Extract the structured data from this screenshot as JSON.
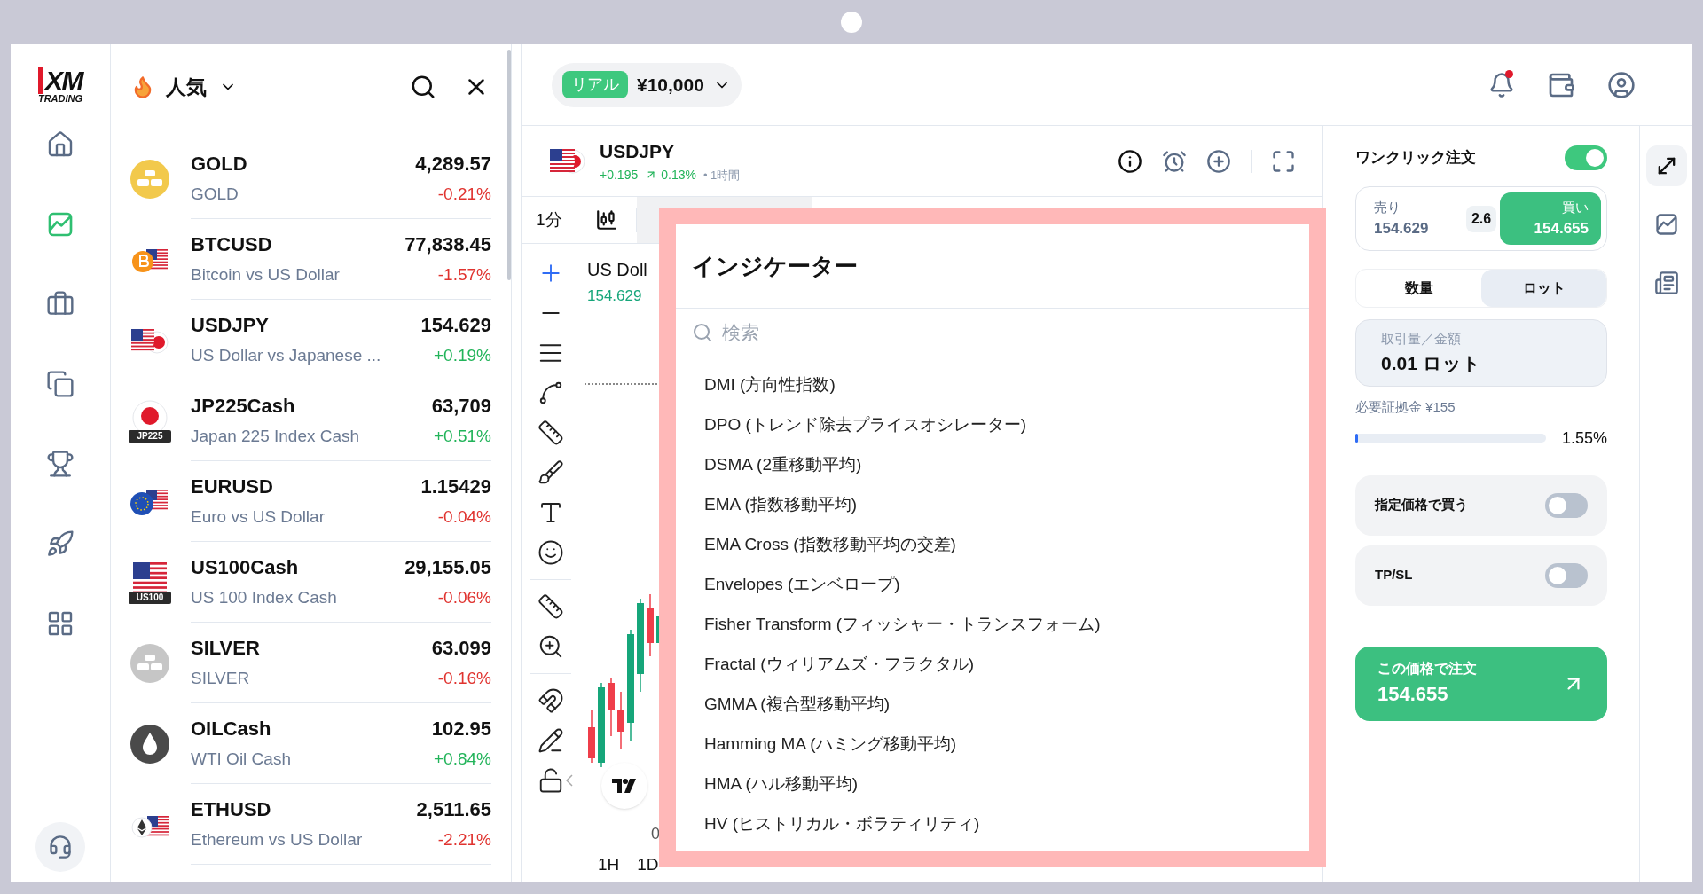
{
  "sidebar": {
    "logo": {
      "mark": "XM",
      "sub": "TRADING"
    },
    "nav": [
      {
        "selected": false
      },
      {
        "selected": true
      },
      {
        "selected": false
      },
      {
        "selected": false
      },
      {
        "selected": false
      },
      {
        "selected": false
      },
      {
        "selected": false
      }
    ]
  },
  "watchlist": {
    "title": "人気",
    "items": [
      {
        "kind": "gold",
        "symbol": "GOLD",
        "name": "GOLD",
        "price": "4,289.57",
        "change": "-0.21%",
        "color": "#e0332f"
      },
      {
        "kind": "btc-usd",
        "symbol": "BTCUSD",
        "name": "Bitcoin vs US Dollar",
        "price": "77,838.45",
        "change": "-1.57%",
        "color": "#e0332f"
      },
      {
        "kind": "usd-jpy",
        "symbol": "USDJPY",
        "name": "US Dollar vs Japanese ...",
        "price": "154.629",
        "change": "+0.19%",
        "color": "#22b45a"
      },
      {
        "kind": "jp-index",
        "badge": "JP225",
        "symbol": "JP225Cash",
        "name": "Japan 225 Index Cash",
        "price": "63,709",
        "change": "+0.51%",
        "color": "#22b45a"
      },
      {
        "kind": "eur-usd",
        "symbol": "EURUSD",
        "name": "Euro vs US Dollar",
        "price": "1.15429",
        "change": "-0.04%",
        "color": "#e0332f"
      },
      {
        "kind": "us-index",
        "badge": "US100",
        "symbol": "US100Cash",
        "name": "US 100 Index Cash",
        "price": "29,155.05",
        "change": "-0.06%",
        "color": "#e0332f"
      },
      {
        "kind": "silver",
        "symbol": "SILVER",
        "name": "SILVER",
        "price": "63.099",
        "change": "-0.16%",
        "color": "#e0332f"
      },
      {
        "kind": "oil",
        "symbol": "OILCash",
        "name": "WTI Oil Cash",
        "price": "102.95",
        "change": "+0.84%",
        "color": "#22b45a"
      },
      {
        "kind": "eth-usd",
        "symbol": "ETHUSD",
        "name": "Ethereum vs US Dollar",
        "price": "2,511.65",
        "change": "-2.21%",
        "color": "#e0332f"
      }
    ]
  },
  "account": {
    "type": "リアル",
    "balance": "¥10,000"
  },
  "notifications": {
    "unread": true
  },
  "instrument": {
    "symbol": "USDJPY",
    "change": "+0.195",
    "percent": "0.13%",
    "timeframe": "• 1時間"
  },
  "chart": {
    "interval": "1分",
    "title": "US Doll",
    "price": "154.629",
    "axis_label": "0",
    "ranges": [
      "1H",
      "1D"
    ]
  },
  "indicators_dialog": {
    "title": "インジケーター",
    "search_placeholder": "検索",
    "items": [
      "DMI (方向性指数)",
      "DPO (トレンド除去プライスオシレーター)",
      "DSMA (2重移動平均)",
      "EMA (指数移動平均)",
      "EMA Cross (指数移動平均の交差)",
      "Envelopes (エンベロープ)",
      "Fisher Transform (フィッシャー・トランスフォーム)",
      "Fractal (ウィリアムズ・フラクタル)",
      "GMMA (複合型移動平均)",
      "Hamming MA (ハミング移動平均)",
      "HMA (ハル移動平均)",
      "HV (ヒストリカル・ボラティリティ)"
    ]
  },
  "order": {
    "one_click": {
      "label": "ワンクリック注文",
      "on": true
    },
    "sell": {
      "label": "売り",
      "price": "154.629",
      "selected": false
    },
    "spread": "2.6",
    "buy": {
      "label": "買い",
      "price": "154.655",
      "selected": true
    },
    "units": [
      {
        "label": "数量",
        "selected": false
      },
      {
        "label": "ロット",
        "selected": true
      }
    ],
    "volume": {
      "label": "取引量／金額",
      "value": "0.01 ロット"
    },
    "margin": {
      "label": "必要証拠金 ¥155",
      "level": 0.0155,
      "reading": "1.55%"
    },
    "options": [
      {
        "label": "指定価格で買う",
        "on": false
      },
      {
        "label": "TP/SL",
        "on": false
      }
    ],
    "submit": {
      "label": "この価格で注文",
      "price": "154.655"
    }
  },
  "side_tools": [
    {
      "selected": true
    },
    {
      "selected": false
    },
    {
      "selected": false
    }
  ]
}
